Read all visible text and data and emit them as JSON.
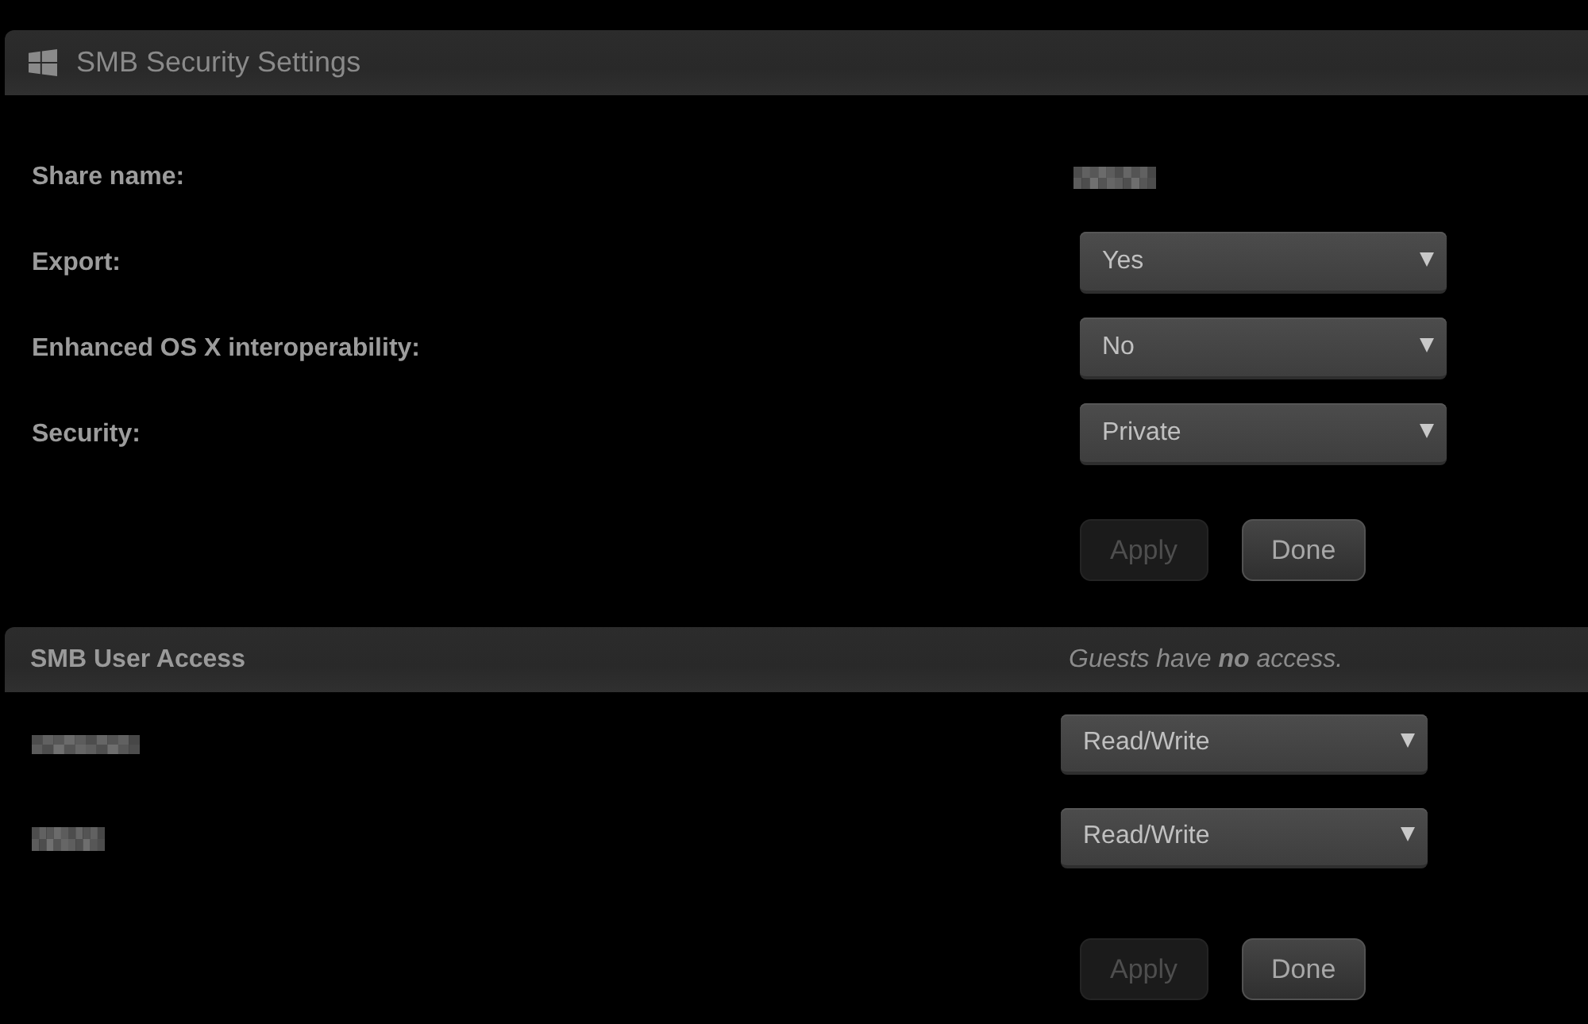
{
  "security_settings": {
    "title": "SMB Security Settings",
    "fields": [
      {
        "kind": "text",
        "label": "Share name:",
        "value_redacted": true
      },
      {
        "kind": "select",
        "label": "Export:",
        "value": "Yes"
      },
      {
        "kind": "select",
        "label": "Enhanced OS X interoperability:",
        "value": "No"
      },
      {
        "kind": "select",
        "label": "Security:",
        "value": "Private"
      }
    ],
    "buttons": [
      {
        "label": "Apply",
        "disabled": true
      },
      {
        "label": "Done",
        "disabled": false
      }
    ]
  },
  "user_access": {
    "title": "SMB User Access",
    "note": "Guests have **no** access.",
    "users": [
      {
        "name_redacted": true,
        "access": "Read/Write"
      },
      {
        "name_redacted": true,
        "access": "Read/Write"
      }
    ],
    "buttons": [
      {
        "label": "Apply",
        "disabled": true
      },
      {
        "label": "Done",
        "disabled": false
      }
    ]
  }
}
